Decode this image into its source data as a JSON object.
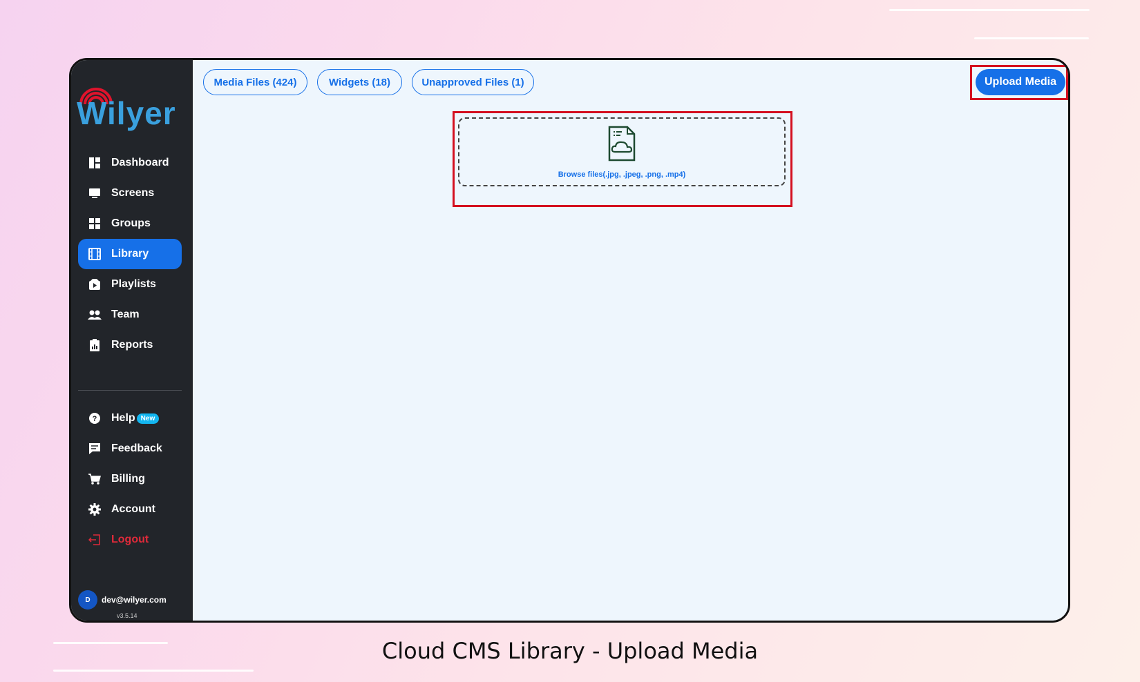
{
  "brand": {
    "name": "Wilyer",
    "logo_color": "#3aa0de",
    "signal_color": "#e0132c"
  },
  "sidebar": {
    "items": [
      {
        "label": "Dashboard",
        "icon": "dashboard-icon"
      },
      {
        "label": "Screens",
        "icon": "monitor-icon"
      },
      {
        "label": "Groups",
        "icon": "grid-icon"
      },
      {
        "label": "Library",
        "icon": "film-icon",
        "active": true
      },
      {
        "label": "Playlists",
        "icon": "playlist-icon"
      },
      {
        "label": "Team",
        "icon": "team-icon"
      },
      {
        "label": "Reports",
        "icon": "clipboard-icon"
      }
    ],
    "secondary_items": [
      {
        "label": "Help",
        "icon": "help-icon",
        "badge": "New"
      },
      {
        "label": "Feedback",
        "icon": "feedback-icon"
      },
      {
        "label": "Billing",
        "icon": "cart-icon"
      },
      {
        "label": "Account",
        "icon": "gear-icon"
      },
      {
        "label": "Logout",
        "icon": "logout-icon"
      }
    ],
    "user": {
      "avatar_initial": "D",
      "email": "dev@wilyer.com"
    },
    "version": "v3.5.14"
  },
  "tabs": [
    {
      "label": "Media Files (424)"
    },
    {
      "label": "Widgets (18)"
    },
    {
      "label": "Unapproved Files (1)"
    }
  ],
  "upload_button": {
    "label": "Upload Media"
  },
  "dropzone": {
    "label": "Browse files(.jpg, .jpeg, .png, .mp4)",
    "icon": "cloud-file-icon"
  },
  "caption": "Cloud CMS Library - Upload Media",
  "colors": {
    "accent": "#1670e8",
    "sidebar_bg": "#22252a",
    "highlight": "#d40f1f",
    "logout": "#e02a3a",
    "badge": "#13b6f0"
  }
}
